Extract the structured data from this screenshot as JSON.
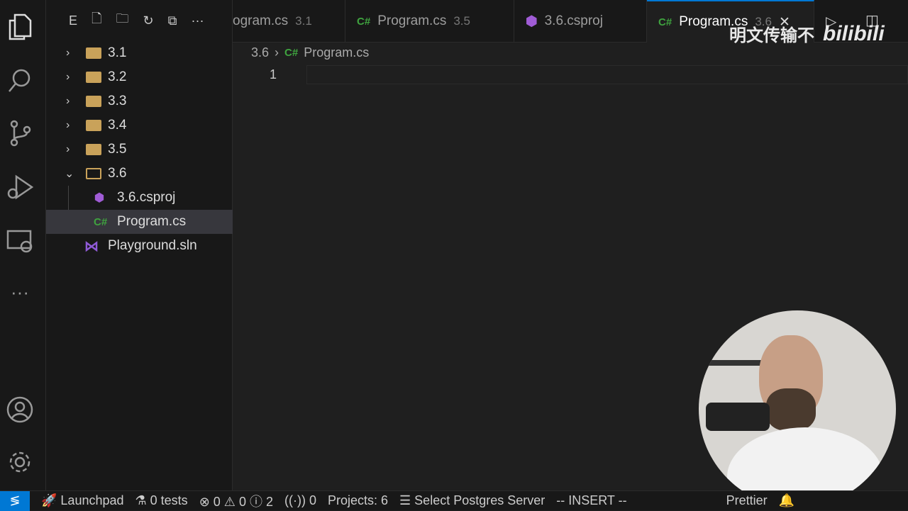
{
  "activity_bar": {
    "icons": [
      "files-icon",
      "search-icon",
      "source-control-icon",
      "run-debug-icon",
      "remote-explorer-icon",
      "more-icon",
      "account-icon",
      "settings-gear-icon"
    ]
  },
  "sidebar": {
    "header_letter": "E",
    "tree": [
      {
        "label": "3.1",
        "type": "folder",
        "expanded": false
      },
      {
        "label": "3.2",
        "type": "folder",
        "expanded": false
      },
      {
        "label": "3.3",
        "type": "folder",
        "expanded": false
      },
      {
        "label": "3.4",
        "type": "folder",
        "expanded": false
      },
      {
        "label": "3.5",
        "type": "folder",
        "expanded": false
      },
      {
        "label": "3.6",
        "type": "folder",
        "expanded": true
      },
      {
        "label": "3.6.csproj",
        "type": "csproj"
      },
      {
        "label": "Program.cs",
        "type": "cs",
        "selected": true
      },
      {
        "label": "Playground.sln",
        "type": "sln"
      }
    ]
  },
  "tabs": [
    {
      "label": "ogram.cs",
      "sub": "3.1"
    },
    {
      "label": "Program.cs",
      "sub": "3.5",
      "icon": "C#"
    },
    {
      "label": "3.6.csproj",
      "sub": ""
    },
    {
      "label": "Program.cs",
      "sub": "3.6",
      "icon": "C#",
      "active": true
    }
  ],
  "breadcrumb": {
    "folder": "3.6",
    "icon": "C#",
    "file": "Program.cs"
  },
  "editor": {
    "line_number": "1"
  },
  "status": {
    "launchpad": "Launchpad",
    "tests": "0 tests",
    "errors": "0",
    "warnings": "0",
    "infos": "2",
    "ports": "0",
    "projects": "Projects: 6",
    "postgres": "Select Postgres Server",
    "mode": "-- INSERT --",
    "prettier": "Prettier"
  },
  "watermark": {
    "text": "明文传输不",
    "logo": "bilibili"
  },
  "colors": {
    "accent": "#0078d4",
    "csharp": "#3fa33f",
    "folder": "#c9a25a"
  }
}
